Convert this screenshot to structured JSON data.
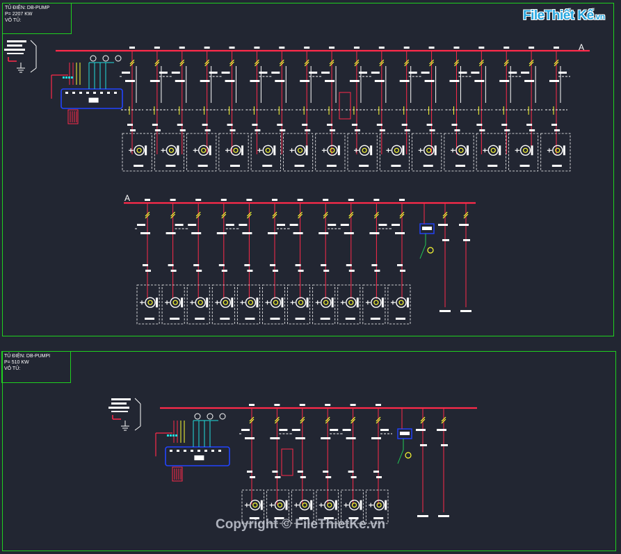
{
  "colors": {
    "background": "#222632",
    "frame": "#1fd11f",
    "bus": "#ff2a4a",
    "feeder": "#ff2a4a",
    "device": "#ffffff",
    "breaker": "#ffff33",
    "panel": "#2244ff",
    "control": "#22dddd",
    "earth": "#22cc55"
  },
  "logo": {
    "text": "FileThiết Kế",
    "suffix": ".vn"
  },
  "watermark": "Copyright © FileThietKe.vn",
  "panels": [
    {
      "id": "panel-1",
      "title_lines": [
        "TỦ ĐIỆN: DB-PUMP",
        "P= 2207 KW",
        "VỎ TỦ:"
      ],
      "bus_label_right": "A",
      "rows": [
        {
          "feeders": 18,
          "motor_cells": 14
        },
        {
          "bus_label_left": "A",
          "feeders": 14,
          "motor_cells": 11
        }
      ]
    },
    {
      "id": "panel-2",
      "title_lines": [
        "TỦ ĐIỆN: DB-PUMPI",
        "P= 510 KW",
        "VỎ TỦ:"
      ],
      "rows": [
        {
          "feeders": 9,
          "motor_cells": 6
        }
      ]
    }
  ]
}
